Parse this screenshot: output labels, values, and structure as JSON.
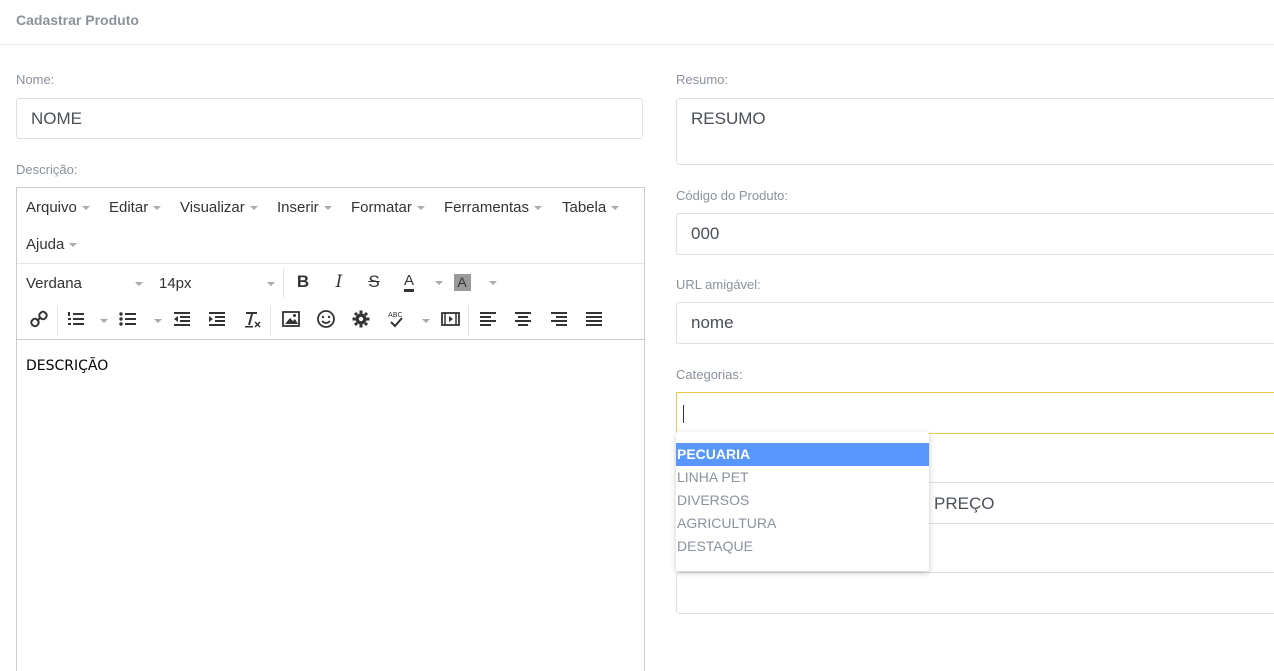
{
  "page": {
    "title": "Cadastrar Produto"
  },
  "fields": {
    "nome": {
      "label": "Nome:",
      "value": "NOME"
    },
    "descricao": {
      "label": "Descrição:",
      "content": "DESCRIÇÃO"
    },
    "resumo": {
      "label": "Resumo:",
      "value": "RESUMO"
    },
    "codigo": {
      "label": "Código do Produto:",
      "value": "000"
    },
    "url": {
      "label": "URL amigável:",
      "value": "nome"
    },
    "categorias": {
      "label": "Categorias:",
      "value": ""
    },
    "preco": {
      "value": "PREÇO"
    }
  },
  "editor": {
    "menus": [
      "Arquivo",
      "Editar",
      "Visualizar",
      "Inserir",
      "Formatar",
      "Ferramentas",
      "Tabela",
      "Ajuda"
    ],
    "font_family": "Verdana",
    "font_size": "14px",
    "text_color_label": "A",
    "bg_color_label": "A"
  },
  "dropdown": {
    "options": [
      "PECUARIA",
      "LINHA PET",
      "DIVERSOS",
      "AGRICULTURA",
      "DESTAQUE"
    ],
    "highlighted": "PECUARIA",
    "highlight_color": "#5897fb"
  },
  "colors": {
    "focus_border": "#f2c84c",
    "label": "#8a929c"
  }
}
